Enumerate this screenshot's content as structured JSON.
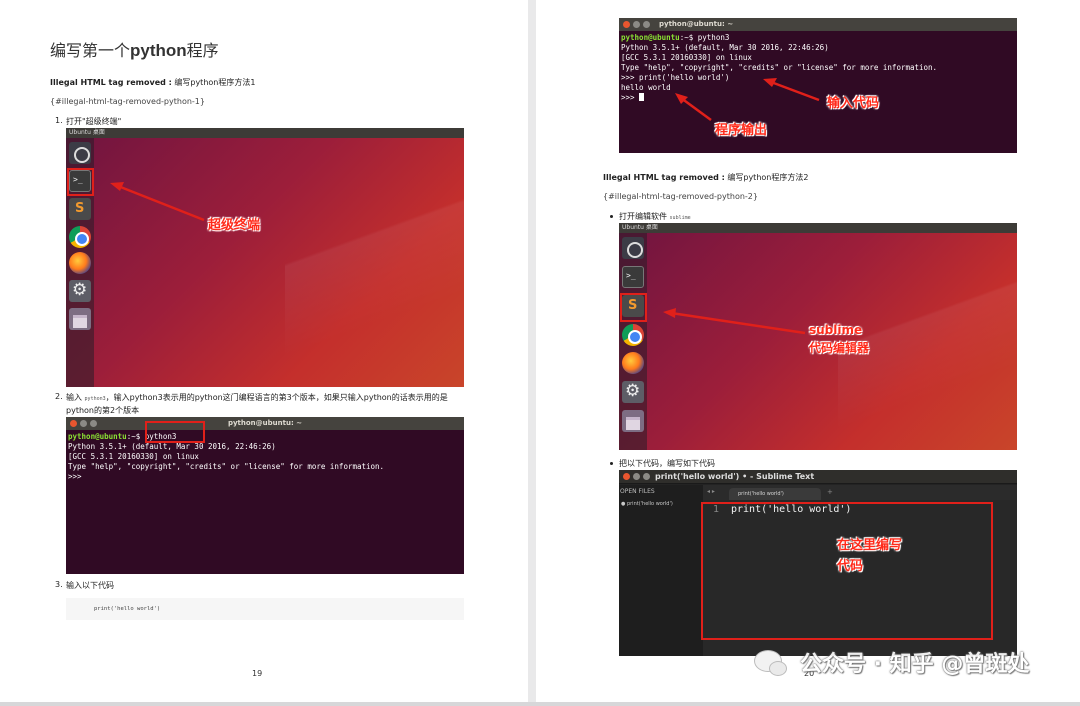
{
  "left_page": {
    "title_prefix": "编写第一个",
    "title_bold": "python",
    "title_suffix": "程序",
    "subhead_bold": "Illegal HTML tag removed :",
    "subhead_rest": " 编写python程序方法1",
    "anchor": "{#illegal-html-tag-removed-python-1}",
    "step1_num": "1.",
    "step1_text": "打开\"超级终端\"",
    "step2_num": "2.",
    "step2_prefix": "输入",
    "step2_code": "python3",
    "step2_text_line1": "，输入python3表示用的python这门编程语言的第3个版本，如果只输入python的话表示用的是",
    "step2_text_line2": "python的第2个版本",
    "step3_num": "3.",
    "step3_text": "输入以下代码",
    "code_block": "print('hello world')",
    "page_number": "19",
    "desktop1": {
      "topbar": "Ubuntu 桌面",
      "annotation": "超级终端"
    },
    "terminal1": {
      "title": "python@ubuntu: ~",
      "prompt_user": "python@ubuntu",
      "prompt_rest": ":~$ ",
      "command": "python3",
      "line2": "Python 3.5.1+ (default, Mar 30 2016, 22:46:26)",
      "line3": "[GCC 5.3.1 20160330] on linux",
      "line4": "Type \"help\", \"copyright\", \"credits\" or \"license\" for more information.",
      "line5": ">>>"
    }
  },
  "right_page": {
    "terminal2": {
      "title": "python@ubuntu: ~",
      "prompt_user": "python@ubuntu",
      "prompt_rest": ":~$ python3",
      "line2": "Python 3.5.1+ (default, Mar 30 2016, 22:46:26)",
      "line3": "[GCC 5.3.1 20160330] on linux",
      "line4": "Type \"help\", \"copyright\", \"credits\" or \"license\" for more information.",
      "line5": ">>> print('hello world')",
      "line6": "hello world",
      "line7": ">>> ",
      "annotation_input": "输入代码",
      "annotation_output": "程序输出"
    },
    "subhead_bold": "Illegal HTML tag removed :",
    "subhead_rest": " 编写python程序方法2",
    "anchor": "{#illegal-html-tag-removed-python-2}",
    "bullet1_text": "打开编辑软件",
    "bullet1_code": "sublime",
    "desktop2": {
      "topbar": "Ubuntu 桌面",
      "annotation_line1": "sublime",
      "annotation_line2": "代码编辑器"
    },
    "bullet2_text": "把以下代码，编写如下代码",
    "sublime": {
      "title": "print('hello world') • - Sublime Text",
      "sidebar_header": "OPEN FILES",
      "sidebar_file": "● print('hello world')",
      "tab_nav": "◂ ▸",
      "tab_label": "print('hello world')",
      "tab_plus": "+",
      "line_number": "1",
      "code": "print('hello world')",
      "annotation_line1": "在这里编写",
      "annotation_line2": "代码"
    },
    "page_number": "20"
  },
  "watermark": {
    "text": "公众号 · 知乎 @曾斑处"
  },
  "colors": {
    "annotation_red": "#ff2a1a",
    "terminal_bg": "#300a24",
    "prompt_green": "#8ae234",
    "page_bg": "#e9e9ea"
  },
  "icons": [
    "dash-icon",
    "terminal-icon",
    "sublime-icon",
    "chrome-icon",
    "firefox-icon",
    "settings-icon",
    "files-icon"
  ]
}
